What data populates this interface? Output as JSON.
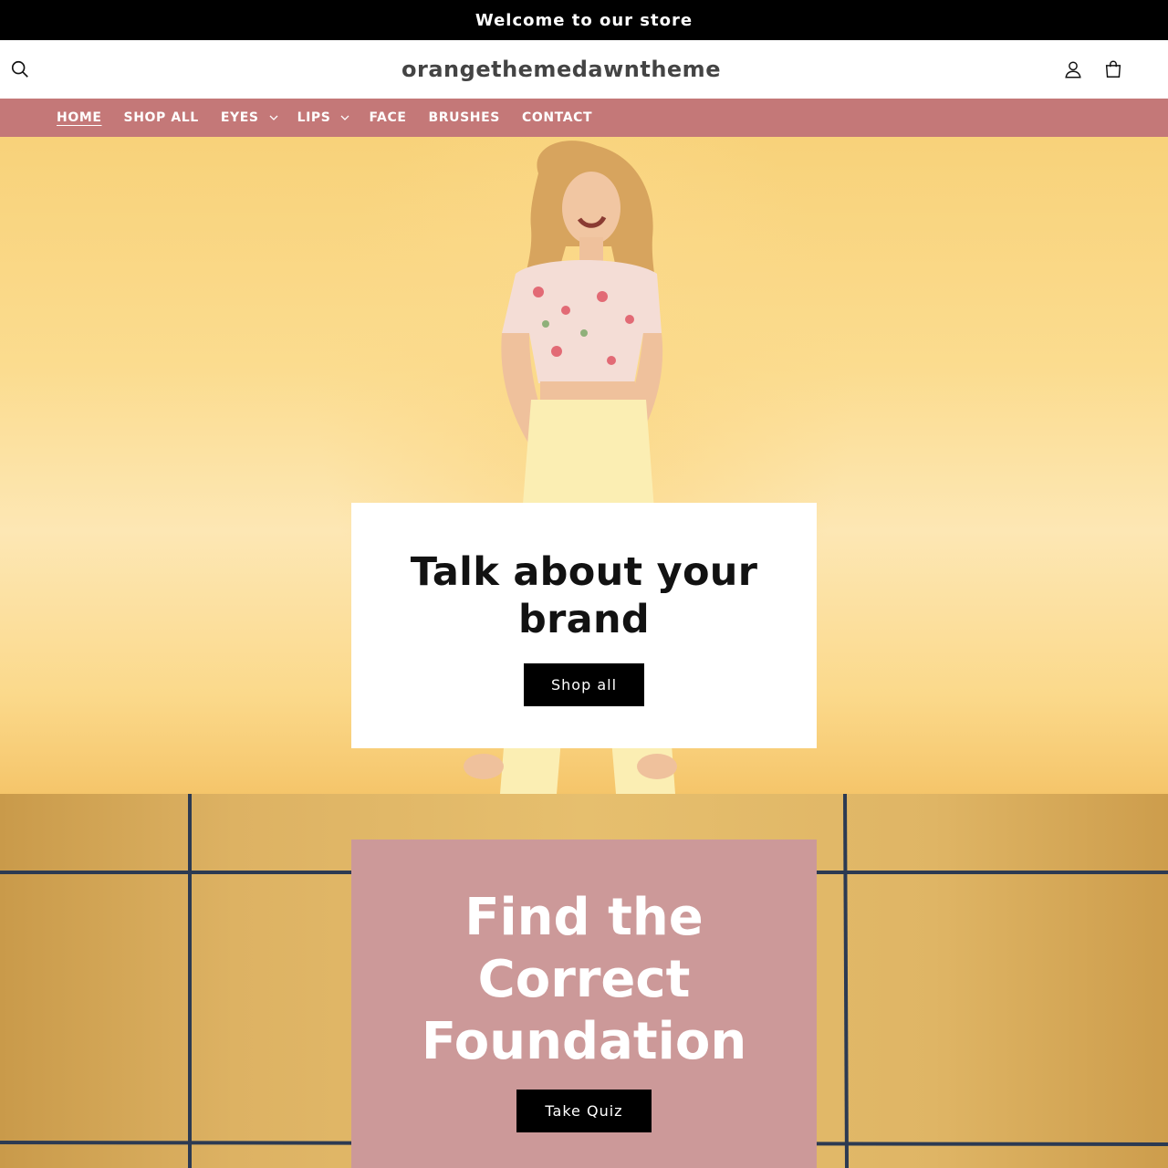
{
  "announcement": {
    "text": "Welcome to our store"
  },
  "header": {
    "logo": "orangethemedawntheme",
    "icons": [
      "search-icon",
      "account-icon",
      "cart-icon"
    ]
  },
  "nav": {
    "items": [
      {
        "label": "HOME",
        "active": true,
        "dropdown": false
      },
      {
        "label": "SHOP ALL",
        "active": false,
        "dropdown": false
      },
      {
        "label": "EYES",
        "active": false,
        "dropdown": true
      },
      {
        "label": "LIPS",
        "active": false,
        "dropdown": true
      },
      {
        "label": "FACE",
        "active": false,
        "dropdown": false
      },
      {
        "label": "BRUSHES",
        "active": false,
        "dropdown": false
      },
      {
        "label": "CONTACT",
        "active": false,
        "dropdown": false
      }
    ]
  },
  "hero": {
    "heading": "Talk about your brand",
    "button_label": "Shop all"
  },
  "quiz": {
    "heading": "Find the Correct Foundation",
    "button_label": "Take Quiz"
  },
  "colors": {
    "announcement_bg": "#000000",
    "nav_bg": "#c47878",
    "quiz_card_bg": "#cc9999",
    "button_bg": "#000000"
  }
}
